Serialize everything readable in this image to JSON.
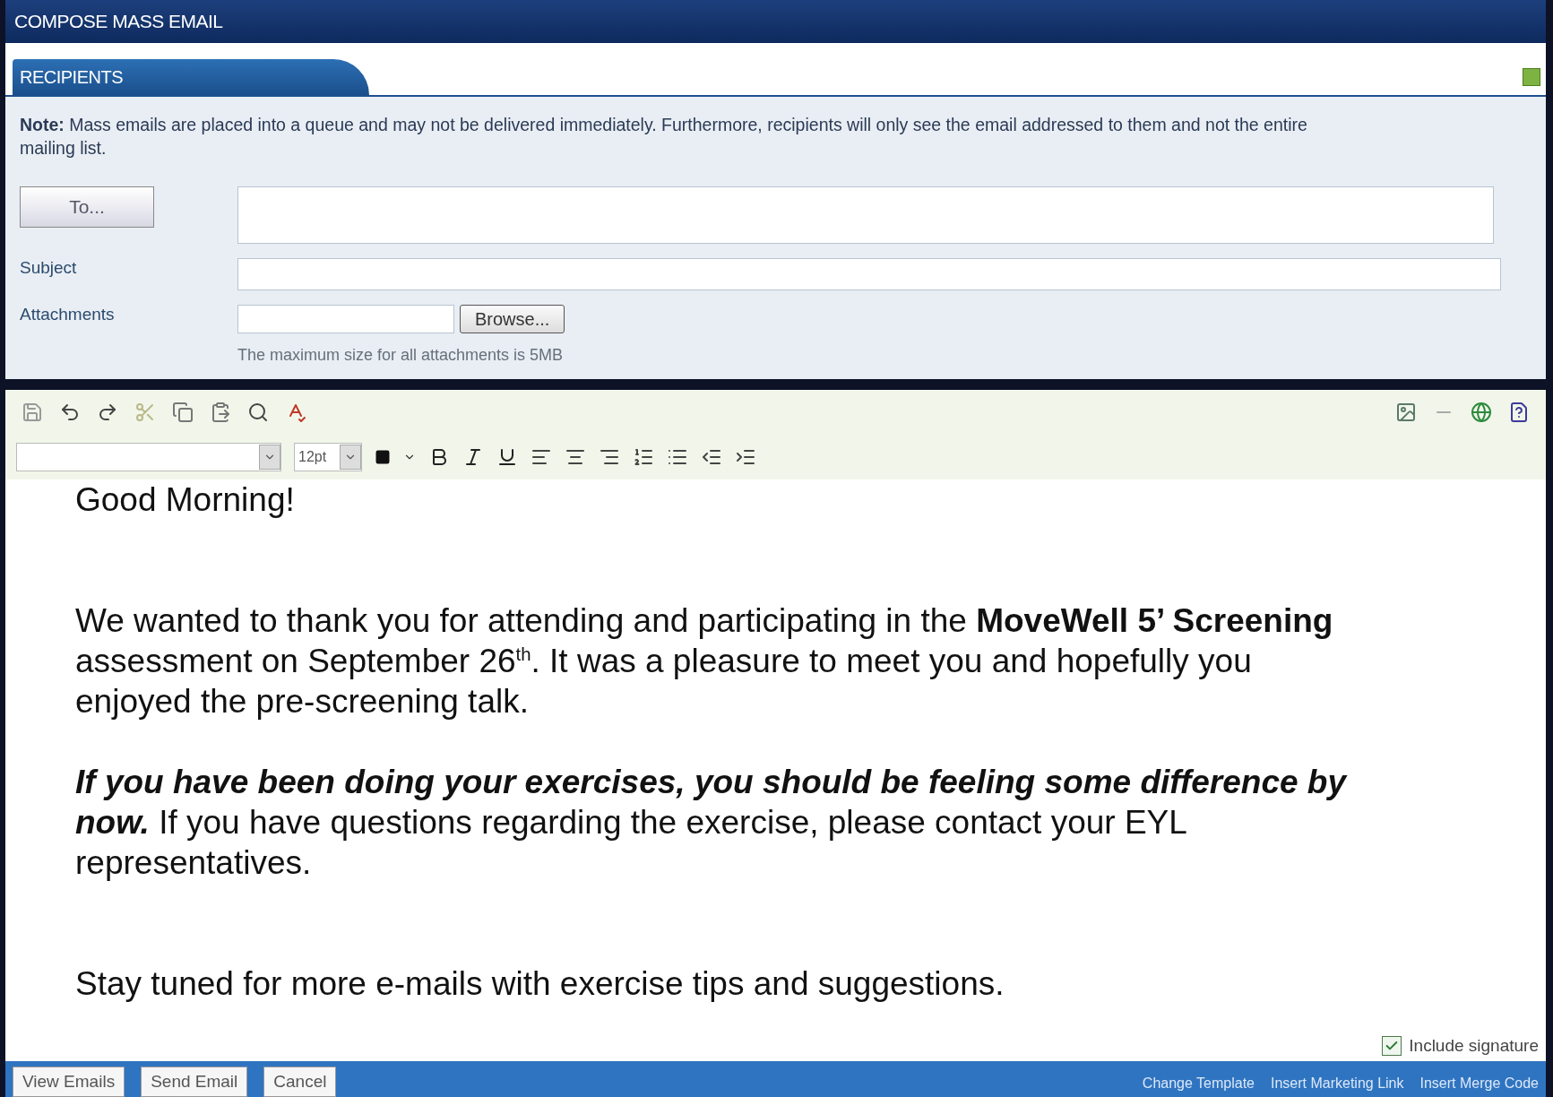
{
  "window": {
    "title": "COMPOSE MASS EMAIL"
  },
  "section_tab": {
    "label": "RECIPIENTS"
  },
  "note": {
    "label": "Note:",
    "text": "Mass emails are placed into a queue and may not be delivered immediately. Furthermore, recipients will only see the email addressed to them and not the entire mailing list."
  },
  "to_button": {
    "label": "To..."
  },
  "subject": {
    "label": "Subject"
  },
  "attachments": {
    "label": "Attachments",
    "browse_label": "Browse...",
    "hint": "The maximum size for all attachments is 5MB"
  },
  "editor": {
    "font_size": "12pt",
    "paragraphs": [
      {
        "kind": "plain",
        "text": "Good Morning!"
      },
      {
        "kind": "spacer"
      },
      {
        "kind": "plain",
        "text": "We wanted to thank you for attending and participating in the **MoveWell 5’ Screening** assessment on September 26$^{th}$.  It was a pleasure to meet you and hopefully you enjoyed the pre-screening talk."
      },
      {
        "kind": "lead",
        "lead": "If you have been doing your exercises, you should be feeling some difference by now.",
        "text": " If you have questions regarding the exercise, please contact your EYL representatives."
      },
      {
        "kind": "spacer"
      },
      {
        "kind": "plain",
        "text": "Stay tuned for more e-mails with exercise tips and suggestions."
      }
    ]
  },
  "include_signature": {
    "label": "Include signature",
    "checked": true
  },
  "footer_buttons": [
    "View Emails",
    "Send Email",
    "Cancel"
  ],
  "footer_links": [
    "Change Template",
    "Insert Marketing Link",
    "Insert Merge Code"
  ]
}
